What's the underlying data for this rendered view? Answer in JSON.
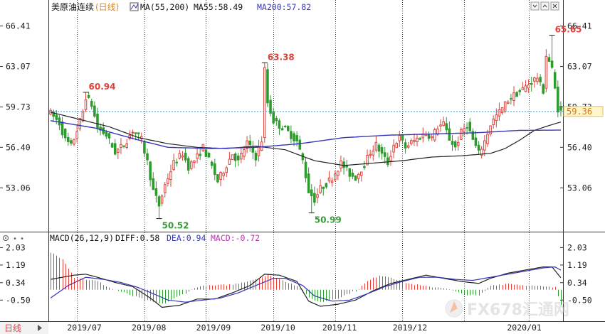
{
  "header": {
    "instrument": "美原油连续",
    "period_tag": "(日线)",
    "ma_label": "MA(55,200)",
    "ma55_text": "MA55:58.49",
    "ma200_text": "MA200:57.82"
  },
  "macd_header": {
    "label": "MACD(26,12,9)",
    "diff_text": "DIFF:0.58",
    "dea_text": "DEA:0.94",
    "macd_text": "MACD:-0.72"
  },
  "period_button": "日线",
  "watermark": "FX678汇通网",
  "colors": {
    "up": "#e0423a",
    "down": "#2f9a2f",
    "ma55": "#222222",
    "ma200": "#3535b5",
    "diff": "#222222",
    "dea": "#3535b5",
    "last_line": "#2aa0e0",
    "badge_bg": "#fff6cc",
    "badge_text": "#d47a1c",
    "grid": "#333333"
  },
  "chart_data": {
    "type": "candlestick",
    "y_ticks": [
      "66.41",
      "63.07",
      "59.73",
      "56.40",
      "53.06"
    ],
    "y_tick_values": [
      66.41,
      63.07,
      59.73,
      56.4,
      53.06
    ],
    "macd_ticks": [
      "2.03",
      "1.19",
      "0.34",
      "-0.50"
    ],
    "macd_tick_values": [
      2.03,
      1.19,
      0.34,
      -0.5
    ],
    "price_range": [
      49.5,
      67.5
    ],
    "macd_range": [
      -1.45,
      2.25
    ],
    "x_labels": [
      "2019/07",
      "2019/08",
      "2019/09",
      "2019/10",
      "2019/11",
      "2019/12",
      "2020/01"
    ],
    "annotations": [
      {
        "text": "60.94",
        "kind": "high",
        "index": 12,
        "value": 60.94
      },
      {
        "text": "50.52",
        "kind": "low",
        "index": 37,
        "value": 50.52
      },
      {
        "text": "63.38",
        "kind": "high",
        "index": 73,
        "value": 63.38
      },
      {
        "text": "50.99",
        "kind": "low",
        "index": 89,
        "value": 50.99
      },
      {
        "text": "65.65",
        "kind": "high",
        "index": 171,
        "value": 65.65
      }
    ],
    "last_price": 59.36,
    "last_price_label": "59.36",
    "ma55_last": 58.49,
    "ma200_last": 57.82,
    "macd_diff_last": 0.58,
    "macd_dea_last": 0.94,
    "macd_hist_last": -0.72,
    "close_anchors": [
      [
        0,
        59.2
      ],
      [
        3,
        58.4
      ],
      [
        5,
        57.0
      ],
      [
        7,
        56.5
      ],
      [
        9,
        57.8
      ],
      [
        11,
        59.3
      ],
      [
        12,
        60.6
      ],
      [
        14,
        59.9
      ],
      [
        16,
        58.0
      ],
      [
        19,
        57.4
      ],
      [
        22,
        56.0
      ],
      [
        25,
        56.6
      ],
      [
        28,
        57.8
      ],
      [
        31,
        57.0
      ],
      [
        33,
        55.2
      ],
      [
        35,
        52.8
      ],
      [
        37,
        51.6
      ],
      [
        39,
        53.3
      ],
      [
        42,
        55.1
      ],
      [
        45,
        55.9
      ],
      [
        47,
        54.8
      ],
      [
        50,
        55.6
      ],
      [
        52,
        56.4
      ],
      [
        55,
        54.8
      ],
      [
        57,
        53.6
      ],
      [
        59,
        54.5
      ],
      [
        62,
        55.9
      ],
      [
        64,
        55.2
      ],
      [
        67,
        56.8
      ],
      [
        70,
        55.6
      ],
      [
        72,
        57.0
      ],
      [
        73,
        62.8
      ],
      [
        74,
        60.1
      ],
      [
        76,
        58.6
      ],
      [
        78,
        58.2
      ],
      [
        80,
        57.9
      ],
      [
        82,
        57.4
      ],
      [
        84,
        56.9
      ],
      [
        86,
        55.3
      ],
      [
        88,
        52.8
      ],
      [
        90,
        52.1
      ],
      [
        92,
        53.0
      ],
      [
        94,
        53.4
      ],
      [
        96,
        53.9
      ],
      [
        99,
        55.1
      ],
      [
        102,
        54.2
      ],
      [
        104,
        53.9
      ],
      [
        107,
        55.0
      ],
      [
        109,
        56.0
      ],
      [
        111,
        56.6
      ],
      [
        113,
        55.8
      ],
      [
        115,
        55.1
      ],
      [
        117,
        56.6
      ],
      [
        119,
        57.2
      ],
      [
        121,
        56.4
      ],
      [
        123,
        56.8
      ],
      [
        125,
        57.1
      ],
      [
        128,
        57.6
      ],
      [
        130,
        57.2
      ],
      [
        132,
        58.1
      ],
      [
        134,
        58.3
      ],
      [
        136,
        57.1
      ],
      [
        138,
        56.4
      ],
      [
        140,
        57.6
      ],
      [
        142,
        58.3
      ],
      [
        144,
        57.0
      ],
      [
        146,
        55.9
      ],
      [
        148,
        56.9
      ],
      [
        150,
        58.3
      ],
      [
        152,
        59.0
      ],
      [
        154,
        59.6
      ],
      [
        156,
        60.3
      ],
      [
        158,
        60.7
      ],
      [
        160,
        61.0
      ],
      [
        162,
        61.4
      ],
      [
        164,
        61.8
      ],
      [
        166,
        62.2
      ],
      [
        167,
        61.5
      ],
      [
        168,
        61.1
      ],
      [
        169,
        64.0
      ],
      [
        170,
        63.5
      ],
      [
        171,
        62.8
      ],
      [
        172,
        61.2
      ],
      [
        173,
        59.6
      ],
      [
        174,
        59.36
      ]
    ],
    "ma55_anchors": [
      [
        0,
        59.3
      ],
      [
        10,
        58.7
      ],
      [
        20,
        58.1
      ],
      [
        30,
        57.2
      ],
      [
        40,
        56.7
      ],
      [
        50,
        56.4
      ],
      [
        60,
        56.3
      ],
      [
        70,
        56.5
      ],
      [
        80,
        56.2
      ],
      [
        90,
        55.3
      ],
      [
        100,
        54.9
      ],
      [
        110,
        55.1
      ],
      [
        120,
        55.3
      ],
      [
        130,
        55.6
      ],
      [
        140,
        55.7
      ],
      [
        150,
        55.9
      ],
      [
        155,
        56.3
      ],
      [
        160,
        57.0
      ],
      [
        165,
        57.8
      ],
      [
        170,
        58.2
      ],
      [
        174,
        58.49
      ]
    ],
    "ma200_anchors": [
      [
        0,
        58.6
      ],
      [
        15,
        58.0
      ],
      [
        30,
        57.0
      ],
      [
        40,
        56.4
      ],
      [
        55,
        56.3
      ],
      [
        70,
        56.4
      ],
      [
        85,
        56.7
      ],
      [
        100,
        57.2
      ],
      [
        115,
        57.4
      ],
      [
        130,
        57.5
      ],
      [
        145,
        57.6
      ],
      [
        160,
        57.8
      ],
      [
        174,
        57.82
      ]
    ],
    "diff_anchors": [
      [
        0,
        0.5
      ],
      [
        8,
        0.7
      ],
      [
        12,
        0.75
      ],
      [
        16,
        0.6
      ],
      [
        22,
        0.35
      ],
      [
        28,
        0.15
      ],
      [
        34,
        -0.4
      ],
      [
        38,
        -0.85
      ],
      [
        44,
        -0.75
      ],
      [
        50,
        -0.45
      ],
      [
        56,
        -0.45
      ],
      [
        62,
        -0.15
      ],
      [
        68,
        0.2
      ],
      [
        73,
        0.75
      ],
      [
        78,
        0.7
      ],
      [
        84,
        0.4
      ],
      [
        88,
        -0.55
      ],
      [
        92,
        -0.8
      ],
      [
        98,
        -0.7
      ],
      [
        104,
        -0.5
      ],
      [
        110,
        -0.05
      ],
      [
        116,
        0.3
      ],
      [
        122,
        0.5
      ],
      [
        128,
        0.7
      ],
      [
        134,
        0.55
      ],
      [
        140,
        0.4
      ],
      [
        146,
        0.3
      ],
      [
        150,
        0.55
      ],
      [
        156,
        0.8
      ],
      [
        162,
        0.95
      ],
      [
        168,
        1.1
      ],
      [
        171,
        1.1
      ],
      [
        174,
        0.58
      ]
    ],
    "dea_anchors": [
      [
        0,
        -0.4
      ],
      [
        6,
        0.2
      ],
      [
        12,
        0.6
      ],
      [
        18,
        0.5
      ],
      [
        24,
        0.35
      ],
      [
        30,
        0.1
      ],
      [
        36,
        -0.25
      ],
      [
        40,
        -0.5
      ],
      [
        46,
        -0.6
      ],
      [
        52,
        -0.5
      ],
      [
        58,
        -0.4
      ],
      [
        64,
        -0.15
      ],
      [
        70,
        0.2
      ],
      [
        76,
        0.55
      ],
      [
        80,
        0.55
      ],
      [
        86,
        0.2
      ],
      [
        90,
        -0.3
      ],
      [
        96,
        -0.55
      ],
      [
        102,
        -0.5
      ],
      [
        108,
        -0.2
      ],
      [
        114,
        0.15
      ],
      [
        120,
        0.4
      ],
      [
        126,
        0.6
      ],
      [
        132,
        0.6
      ],
      [
        138,
        0.5
      ],
      [
        144,
        0.45
      ],
      [
        150,
        0.6
      ],
      [
        156,
        0.75
      ],
      [
        162,
        0.9
      ],
      [
        168,
        1.05
      ],
      [
        172,
        1.1
      ],
      [
        174,
        0.94
      ]
    ],
    "hist_anchors": [
      [
        0,
        1.8
      ],
      [
        4,
        1.5
      ],
      [
        8,
        0.6
      ],
      [
        12,
        0.5
      ],
      [
        16,
        0.4
      ],
      [
        20,
        0.1
      ],
      [
        26,
        -0.2
      ],
      [
        32,
        -0.5
      ],
      [
        38,
        -0.7
      ],
      [
        44,
        -0.3
      ],
      [
        50,
        0.15
      ],
      [
        56,
        0.2
      ],
      [
        62,
        0.25
      ],
      [
        68,
        0.45
      ],
      [
        72,
        0.6
      ],
      [
        74,
        0.7
      ],
      [
        80,
        0.4
      ],
      [
        84,
        0.2
      ],
      [
        88,
        -0.4
      ],
      [
        92,
        -0.6
      ],
      [
        98,
        -0.4
      ],
      [
        104,
        -0.05
      ],
      [
        108,
        0.4
      ],
      [
        112,
        0.7
      ],
      [
        116,
        0.6
      ],
      [
        122,
        0.3
      ],
      [
        128,
        0.15
      ],
      [
        134,
        0.1
      ],
      [
        140,
        -0.2
      ],
      [
        146,
        -0.3
      ],
      [
        150,
        0.2
      ],
      [
        156,
        0.3
      ],
      [
        162,
        0.2
      ],
      [
        168,
        0.15
      ],
      [
        172,
        0.1
      ],
      [
        174,
        -0.72
      ]
    ]
  }
}
